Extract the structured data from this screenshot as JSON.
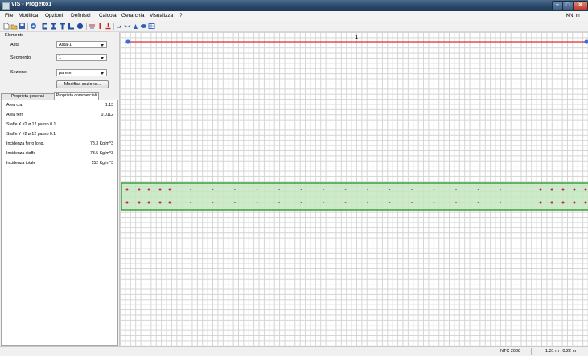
{
  "window": {
    "title": "VIS - Progetto1"
  },
  "menu": {
    "items": [
      "File",
      "Modifica",
      "Opzioni",
      "Definisci",
      "Calcola",
      "Gerarchia",
      "Visualizza",
      "?"
    ],
    "units": "KN, m"
  },
  "panel": {
    "group_label": "Elemento",
    "asta_label": "Asta",
    "asta_value": "Asta-1",
    "segmento_label": "Segmento",
    "segmento_value": "1",
    "sezione_label": "Sezione",
    "sezione_value": "parete",
    "modifica_button": "Modifica sezione...",
    "tabs": [
      "Proprietà generali",
      "Proprietà commerciali"
    ],
    "properties": [
      {
        "label": "Area c.a.",
        "value": "1.13"
      },
      {
        "label": "Area ferri",
        "value": "0.0112"
      },
      {
        "label": "Staffe X    #2 ø 12 passo 0.1",
        "value": ""
      },
      {
        "label": "Staffe Y    #2 ø 12 passo 0.1",
        "value": ""
      },
      {
        "label": "Incidenza ferro long.",
        "value": "78.3 Kg/m^3"
      },
      {
        "label": "Incidenza staffe",
        "value": "73.5 Kg/m^3"
      },
      {
        "label": "Incidenza totale",
        "value": "152 Kg/m^3"
      }
    ]
  },
  "canvas": {
    "segment_label": "1"
  },
  "status": {
    "norm": "NTC 2008",
    "coords": "1.31 m ; 0.22 m"
  },
  "colors": {
    "beam_line": "#e03030",
    "node": "#3a6fd8",
    "section_fill": "#c6e8c0",
    "section_border": "#2f9a2f",
    "rebar": "#c0204a"
  }
}
